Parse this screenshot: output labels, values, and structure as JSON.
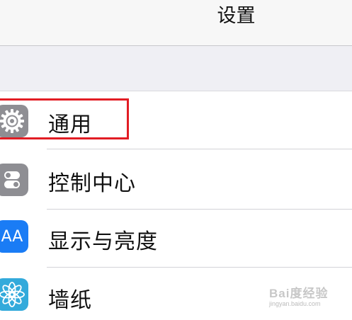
{
  "header": {
    "title": "设置"
  },
  "settings": {
    "items": [
      {
        "label": "通用",
        "icon": "gear-icon",
        "icon_color": "#8e8e93"
      },
      {
        "label": "控制中心",
        "icon": "toggle-switches-icon",
        "icon_color": "#8e8e93"
      },
      {
        "label": "显示与亮度",
        "icon": "text-size-icon",
        "icon_color": "#1a7cf5",
        "icon_text": "AA"
      },
      {
        "label": "墙纸",
        "icon": "flower-icon",
        "icon_color": "#33aadb"
      }
    ]
  },
  "annotation": {
    "highlight_color": "#e21d24",
    "highlighted_item": "通用"
  },
  "watermark": {
    "brand": "Bai度经验",
    "url": "jingyan.baidu.com"
  }
}
